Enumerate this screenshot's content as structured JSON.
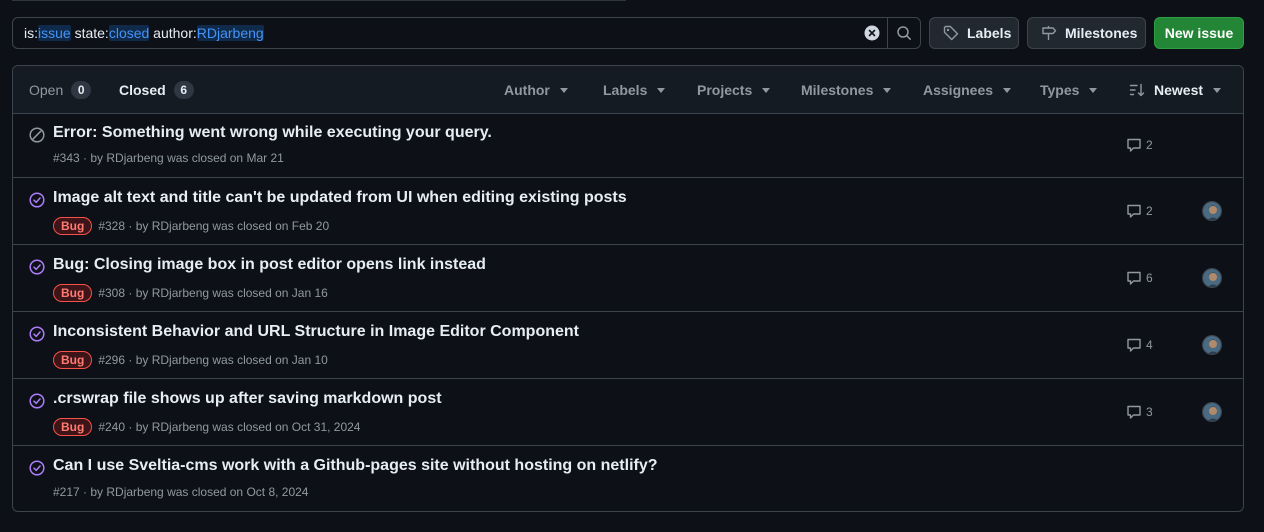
{
  "search": {
    "tokens": [
      {
        "key": "is:",
        "value": "issue"
      },
      {
        "key": " state:",
        "value": "closed"
      },
      {
        "key": " author:",
        "value": "RDjarbeng"
      }
    ]
  },
  "toolbar": {
    "labels_button": "Labels",
    "milestones_button": "Milestones",
    "new_issue_button": "New issue"
  },
  "tabs": {
    "open_label": "Open",
    "open_count": "0",
    "closed_label": "Closed",
    "closed_count": "6"
  },
  "filters": {
    "author": "Author",
    "labels": "Labels",
    "projects": "Projects",
    "milestones": "Milestones",
    "assignees": "Assignees",
    "types": "Types",
    "sort": "Newest"
  },
  "colors": {
    "closed_not_planned": "#9198a1",
    "closed_completed": "#ab7df8",
    "bug_label": "#f85149"
  },
  "issues": [
    {
      "title": "Error: Something went wrong while executing your query.",
      "label": "",
      "meta": "#343 · by RDjarbeng was closed on Mar 21",
      "comments": "2",
      "state": "not-planned",
      "avatar": false
    },
    {
      "title": "Image alt text and title can't be updated from UI when editing existing posts",
      "label": "Bug",
      "meta": "#328 · by RDjarbeng was closed on Feb 20",
      "comments": "2",
      "state": "completed",
      "avatar": true
    },
    {
      "title": "Bug: Closing image box in post editor opens link instead",
      "label": "Bug",
      "meta": "#308 · by RDjarbeng was closed on Jan 16",
      "comments": "6",
      "state": "completed",
      "avatar": true
    },
    {
      "title": "Inconsistent Behavior and URL Structure in Image Editor Component",
      "label": "Bug",
      "meta": "#296 · by RDjarbeng was closed on Jan 10",
      "comments": "4",
      "state": "completed",
      "avatar": true
    },
    {
      "title": ".crswrap file shows up after saving markdown post",
      "label": "Bug",
      "meta": "#240 · by RDjarbeng was closed on Oct 31, 2024",
      "comments": "3",
      "state": "completed",
      "avatar": true
    },
    {
      "title": "Can I use Sveltia-cms work with a Github-pages site without hosting on netlify?",
      "label": "",
      "meta": "#217 · by RDjarbeng was closed on Oct 8, 2024",
      "comments": "",
      "state": "completed",
      "avatar": false
    }
  ]
}
